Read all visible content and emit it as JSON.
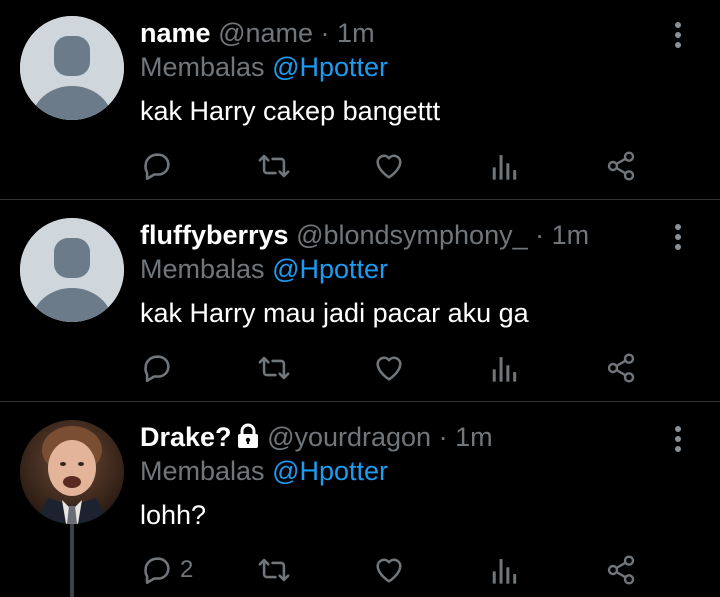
{
  "tweets": [
    {
      "name": "name",
      "handle": "@name",
      "time": "1m",
      "reply_prefix": "Membalas",
      "reply_mention": "@Hpotter",
      "text": "kak Harry cakep bangettt",
      "reply_count": "",
      "locked": false
    },
    {
      "name": "fluffyberrys",
      "handle": "@blondsymphony_",
      "time": "1m",
      "reply_prefix": "Membalas",
      "reply_mention": "@Hpotter",
      "text": "kak Harry mau jadi pacar aku ga",
      "reply_count": "",
      "locked": false
    },
    {
      "name": "Drake?",
      "handle": "@yourdragon",
      "time": "1m",
      "reply_prefix": "Membalas",
      "reply_mention": "@Hpotter",
      "text": "lohh?",
      "reply_count": "2",
      "locked": true
    }
  ],
  "separator": "·",
  "colors": {
    "background": "#000000",
    "text": "#ffffff",
    "muted": "#71767b",
    "mention": "#1d9bf0",
    "divider": "#2f3336"
  },
  "icons": [
    "reply-icon",
    "retweet-icon",
    "like-icon",
    "views-icon",
    "share-icon",
    "more-icon",
    "lock-icon",
    "default-avatar-icon"
  ]
}
